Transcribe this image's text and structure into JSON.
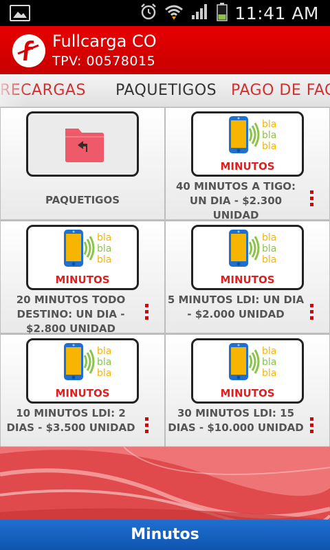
{
  "status_bar": {
    "time": "11:41 AM",
    "icons": [
      "gallery-icon",
      "alarm-icon",
      "wifi-icon",
      "signal-icon",
      "battery-icon"
    ]
  },
  "header": {
    "title": "Fullcarga CO",
    "subtitle": "TPV: 00578015",
    "brand_color": "#d90000"
  },
  "tabs": [
    {
      "label": "RECARGAS"
    },
    {
      "label": "PAQUETIGOS",
      "active": true
    },
    {
      "label": "PAGO DE FAC"
    }
  ],
  "products": [
    {
      "label": "PAQUETIGOS",
      "type": "folder"
    },
    {
      "label": "40 MINUTOS A TIGO: UN DIA - $2.300 UNIDAD",
      "type": "product",
      "badge": "MINUTOS"
    },
    {
      "label": "20 MINUTOS TODO DESTINO: UN DIA - $2.800 UNIDAD",
      "type": "product",
      "badge": "MINUTOS"
    },
    {
      "label": "5 MINUTOS LDI: UN DIA - $2.000 UNIDAD",
      "type": "product",
      "badge": "MINUTOS"
    },
    {
      "label": "10 MINUTOS LDI: 2 DIAS - $3.500 UNIDAD",
      "type": "product",
      "badge": "MINUTOS"
    },
    {
      "label": "30 MINUTOS LDI: 15 DIAS - $10.000 UNIDAD",
      "type": "product",
      "badge": "MINUTOS"
    }
  ],
  "bla_text": "bla",
  "bottom_bar": {
    "label": "Minutos",
    "color": "#1565c0"
  }
}
